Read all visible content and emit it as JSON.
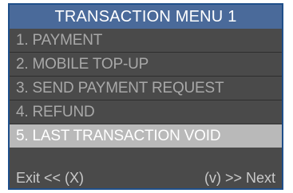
{
  "menu": {
    "title": "TRANSACTION MENU 1",
    "items": [
      {
        "label": "1. PAYMENT"
      },
      {
        "label": "2. MOBILE TOP-UP"
      },
      {
        "label": "3. SEND PAYMENT REQUEST"
      },
      {
        "label": "4. REFUND"
      },
      {
        "label": "5. LAST TRANSACTION VOID",
        "selected": true
      }
    ]
  },
  "footer": {
    "exit_label": "Exit << (X)",
    "next_label": "(v) >> Next"
  },
  "colors": {
    "title_bar": "#4a6a9a",
    "background": "#4a4a4a",
    "selected_row": "#b9b9b9",
    "frame_border": "#1f4f8a"
  }
}
